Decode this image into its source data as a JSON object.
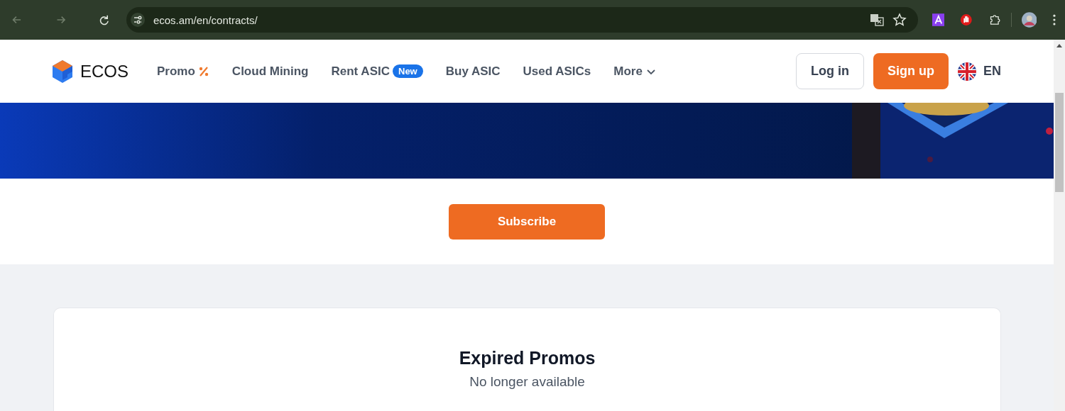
{
  "browser": {
    "url": "ecos.am/en/contracts/"
  },
  "header": {
    "logo": "ECOS",
    "nav": [
      {
        "label": "Promo",
        "kind": "promo"
      },
      {
        "label": "Cloud Mining",
        "kind": "plain"
      },
      {
        "label": "Rent ASIC",
        "kind": "badge",
        "badge": "New"
      },
      {
        "label": "Buy ASIC",
        "kind": "plain"
      },
      {
        "label": "Used ASICs",
        "kind": "plain"
      },
      {
        "label": "More",
        "kind": "dropdown"
      }
    ],
    "login": "Log in",
    "signup": "Sign up",
    "language": "EN"
  },
  "subscribe": "Subscribe",
  "section": {
    "title": "Expired Promos",
    "subtitle": "No longer available"
  }
}
